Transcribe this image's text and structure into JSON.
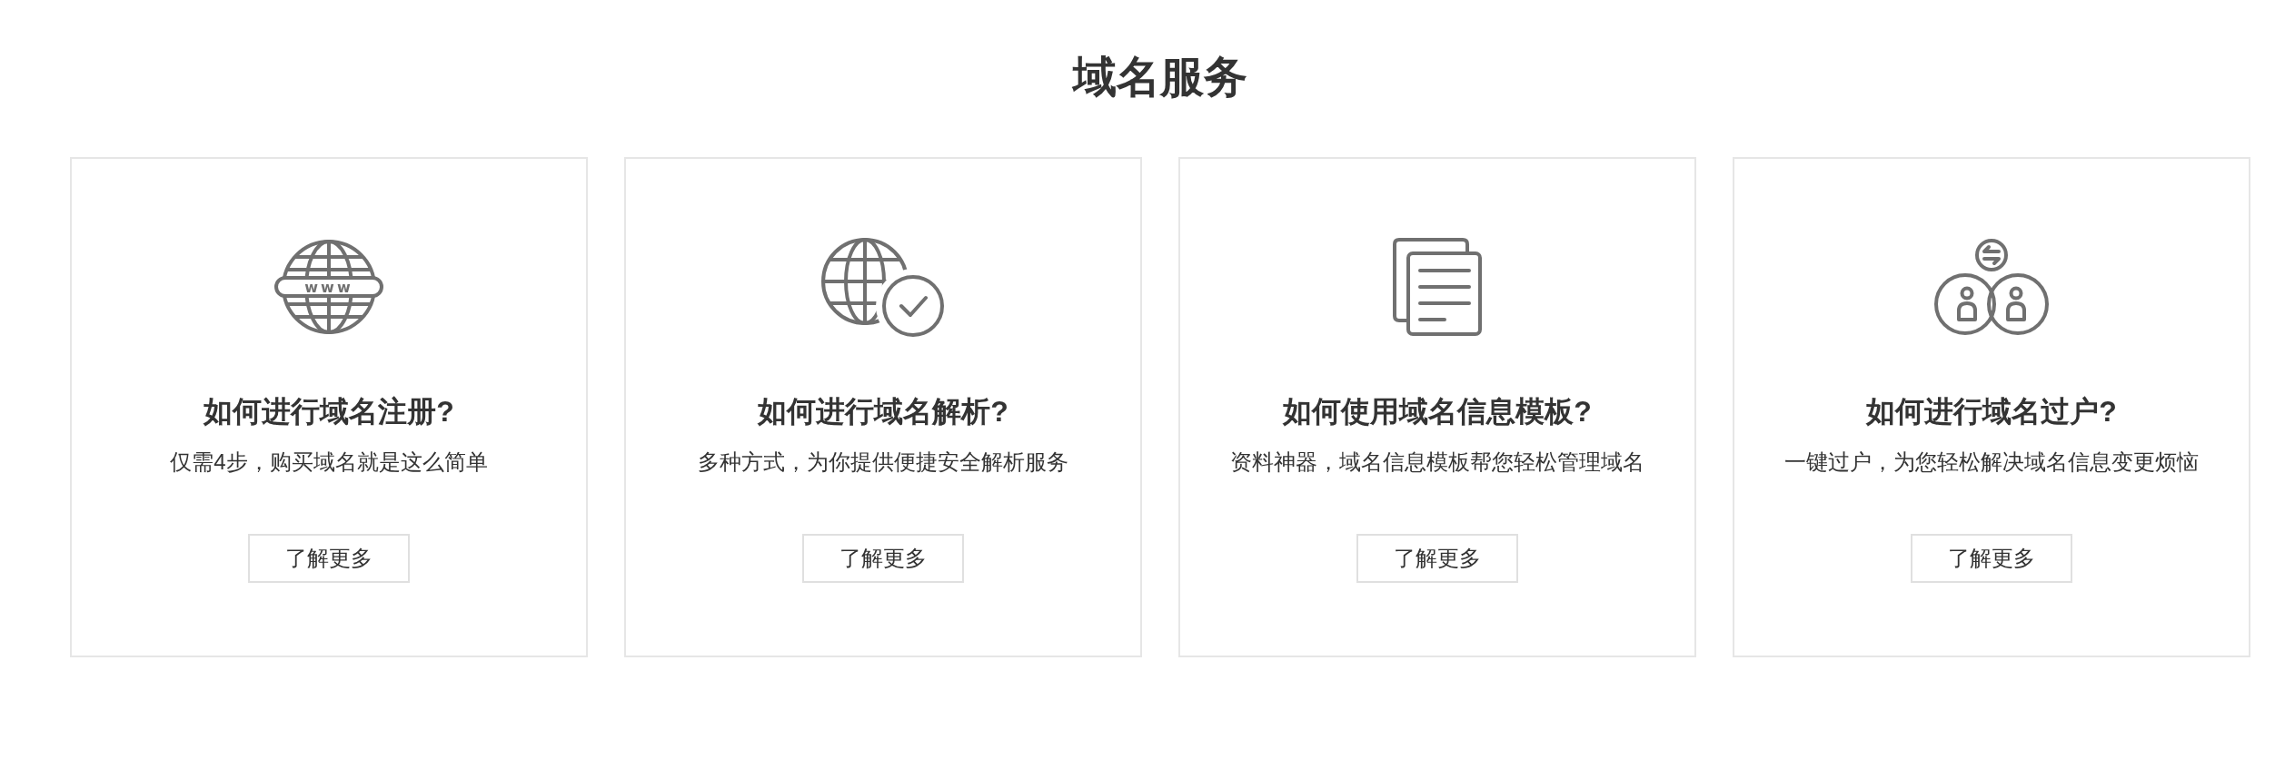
{
  "section": {
    "title": "域名服务"
  },
  "cards": [
    {
      "kind": "globe-www",
      "icon_text": "www",
      "title": "如何进行域名注册?",
      "description": "仅需4步，购买域名就是这么简单",
      "button": "了解更多"
    },
    {
      "kind": "globe-check",
      "title": "如何进行域名解析?",
      "description": "多种方式，为你提供便捷安全解析服务",
      "button": "了解更多"
    },
    {
      "kind": "documents",
      "title": "如何使用域名信息模板?",
      "description": "资料神器，域名信息模板帮您轻松管理域名",
      "button": "了解更多"
    },
    {
      "kind": "people-exchange",
      "title": "如何进行域名过户?",
      "description": "一键过户，为您轻松解决域名信息变更烦恼",
      "button": "了解更多"
    }
  ]
}
